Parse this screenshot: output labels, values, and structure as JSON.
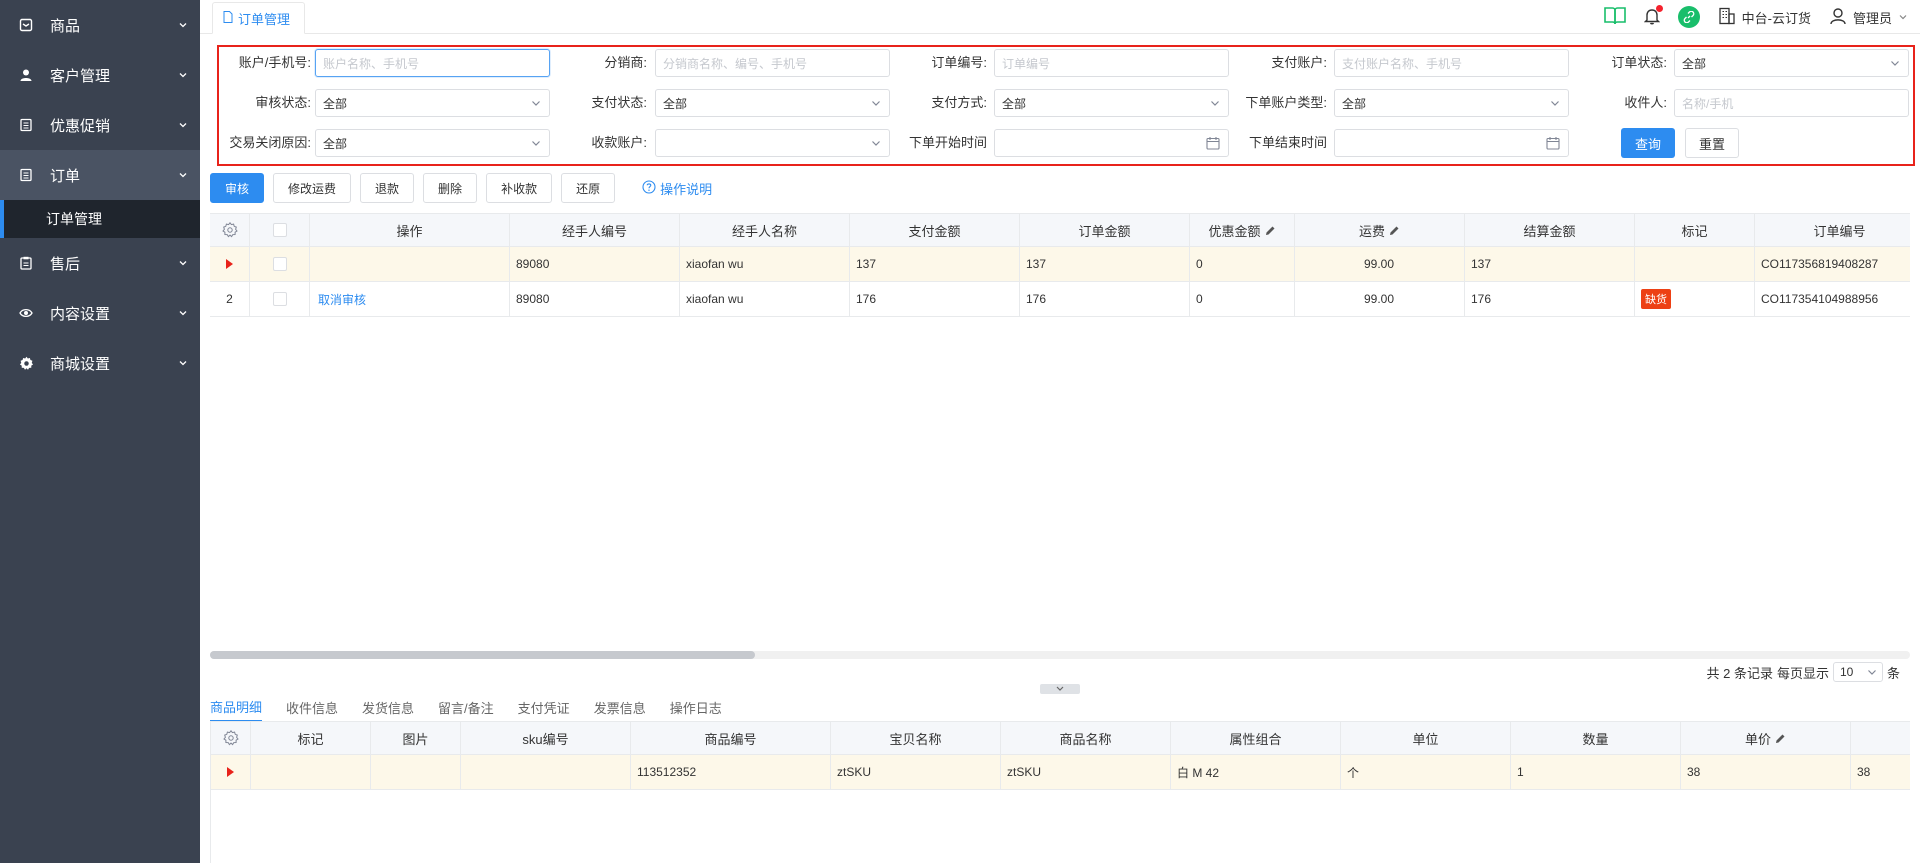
{
  "sidebar": {
    "items": [
      {
        "label": "商品",
        "icon": "box-icon"
      },
      {
        "label": "客户管理",
        "icon": "user-icon"
      },
      {
        "label": "优惠促销",
        "icon": "list-icon"
      },
      {
        "label": "订单",
        "icon": "list-icon"
      },
      {
        "label": "售后",
        "icon": "clipboard-icon"
      },
      {
        "label": "内容设置",
        "icon": "eye-icon"
      },
      {
        "label": "商城设置",
        "icon": "gear-icon"
      }
    ],
    "submenu": {
      "label": "订单管理"
    }
  },
  "header": {
    "tab_label": "订单管理",
    "org_name": "中台-云订货",
    "user_name": "管理员"
  },
  "filter": {
    "account_label": "账户/手机号:",
    "account_placeholder": "账户名称、手机号",
    "distributor_label": "分销商:",
    "distributor_placeholder": "分销商名称、编号、手机号",
    "order_no_label": "订单编号:",
    "order_no_placeholder": "订单编号",
    "pay_account_label": "支付账户:",
    "pay_account_placeholder": "支付账户名称、手机号",
    "order_status_label": "订单状态:",
    "order_status_value": "全部",
    "audit_status_label": "审核状态:",
    "audit_status_value": "全部",
    "pay_status_label": "支付状态:",
    "pay_status_value": "全部",
    "pay_method_label": "支付方式:",
    "pay_method_value": "全部",
    "account_type_label": "下单账户类型:",
    "account_type_value": "全部",
    "receiver_label": "收件人:",
    "receiver_placeholder": "名称/手机",
    "close_reason_label": "交易关闭原因:",
    "close_reason_value": "全部",
    "receive_account_label": "收款账户:",
    "receive_account_value": "",
    "start_time_label": "下单开始时间",
    "end_time_label": "下单结束时间",
    "search_label": "查询",
    "reset_label": "重置"
  },
  "toolbar": {
    "audit": "审核",
    "edit_freight": "修改运费",
    "refund": "退款",
    "delete": "删除",
    "supplement": "补收款",
    "restore": "还原",
    "help": "操作说明"
  },
  "orders": {
    "columns": [
      "操作",
      "经手人编号",
      "经手人名称",
      "支付金额",
      "订单金额",
      "优惠金额",
      "运费",
      "结算金额",
      "标记",
      "订单编号"
    ],
    "rows": [
      {
        "idx": "",
        "action": "",
        "handler_no": "89080",
        "handler_name": "xiaofan wu",
        "pay": "137",
        "amount": "137",
        "discount": "0",
        "freight": "99.00",
        "settle": "137",
        "mark": "",
        "order_no": "CO117356819408287"
      },
      {
        "idx": "2",
        "action": "取消审核",
        "handler_no": "89080",
        "handler_name": "xiaofan wu",
        "pay": "176",
        "amount": "176",
        "discount": "0",
        "freight": "99.00",
        "settle": "176",
        "mark": "缺货",
        "order_no": "CO117354104988956"
      }
    ]
  },
  "pager": {
    "total_text": "共 2 条记录",
    "per_page_label": "每页显示",
    "per_page_value": "10",
    "unit": "条"
  },
  "detail_tabs": [
    "商品明细",
    "收件信息",
    "发货信息",
    "留言/备注",
    "支付凭证",
    "发票信息",
    "操作日志"
  ],
  "items": {
    "columns": [
      "标记",
      "图片",
      "sku编号",
      "商品编号",
      "宝贝名称",
      "商品名称",
      "属性组合",
      "单位",
      "数量",
      "单价"
    ],
    "rows": [
      {
        "mark": "",
        "image": "",
        "sku": "",
        "product_no": "113512352",
        "baby_name": "ztSKU",
        "product_name": "ztSKU",
        "attrs": "白 M 42",
        "unit": "个",
        "qty": "1",
        "price": "38",
        "extra": "38"
      }
    ]
  },
  "colors": {
    "primary": "#2d8cf0",
    "sidebar": "#3a4250",
    "highlight": "#e8231b"
  }
}
